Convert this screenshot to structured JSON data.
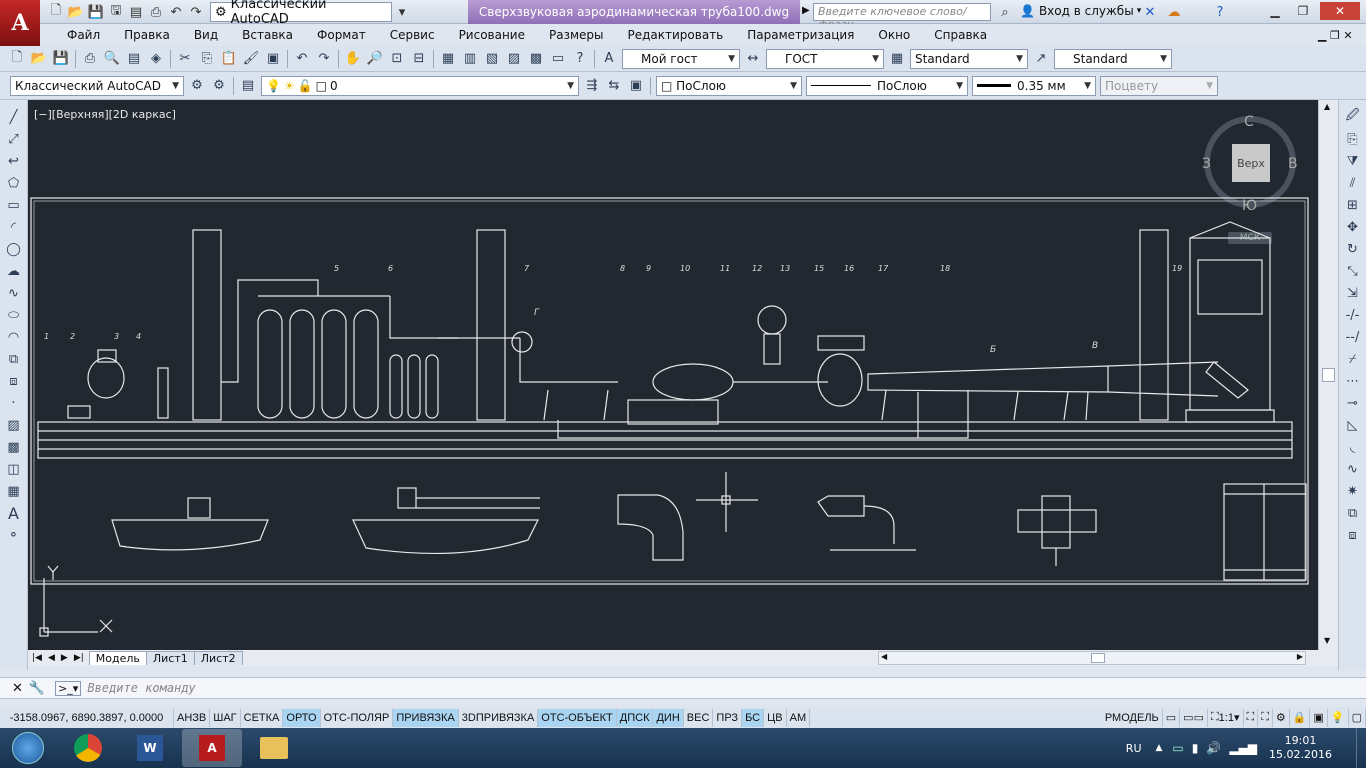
{
  "app": {
    "workspace": "Классический AutoCAD",
    "document_title": "Сверхзвуковая аэродинамическая труба100.dwg",
    "search_placeholder": "Введите ключевое слово/фразу",
    "signin": "Вход в службы"
  },
  "menu": [
    "Файл",
    "Правка",
    "Вид",
    "Вставка",
    "Формат",
    "Сервис",
    "Рисование",
    "Размеры",
    "Редактировать",
    "Параметризация",
    "Окно",
    "Справка"
  ],
  "styles": {
    "text_style": "Мой гост",
    "dim_style": "ГОСТ",
    "table_style": "Standard",
    "multileader_style": "Standard"
  },
  "layers": {
    "workspace": "Классический AutoCAD",
    "current_layer": "0",
    "color": "ПоСлою",
    "linetype": "ПоСлою",
    "lineweight": "0.35 мм",
    "plotstyle": "Поцвету"
  },
  "viewport": {
    "label": "[−][Верхняя][2D каркас]",
    "viewcube": {
      "top": "Верх",
      "n": "С",
      "s": "Ю",
      "w": "З",
      "e": "В",
      "ucs": "МСК"
    }
  },
  "drawing_callouts": [
    "1",
    "2",
    "3",
    "4",
    "5",
    "6",
    "7",
    "8",
    "9",
    "10",
    "11",
    "12",
    "13",
    "15",
    "16",
    "17",
    "18",
    "19",
    "Г",
    "Б",
    "В"
  ],
  "layout_tabs": [
    "Модель",
    "Лист1",
    "Лист2"
  ],
  "command_placeholder": "Введите команду",
  "status": {
    "coords": "-3158.0967, 6890.3897, 0.0000",
    "toggles": [
      {
        "label": "АНЗВ",
        "on": false
      },
      {
        "label": "ШАГ",
        "on": false
      },
      {
        "label": "СЕТКА",
        "on": false
      },
      {
        "label": "ОРТО",
        "on": true
      },
      {
        "label": "ОТС-ПОЛЯР",
        "on": false
      },
      {
        "label": "ПРИВЯЗКА",
        "on": true
      },
      {
        "label": "3DПРИВЯЗКА",
        "on": false
      },
      {
        "label": "ОТС-ОБЪЕКТ",
        "on": true
      },
      {
        "label": "ДПСК",
        "on": true
      },
      {
        "label": "ДИН",
        "on": true
      },
      {
        "label": "ВЕС",
        "on": false
      },
      {
        "label": "ПРЗ",
        "on": false
      },
      {
        "label": "БС",
        "on": true
      },
      {
        "label": "ЦВ",
        "on": false
      },
      {
        "label": "АМ",
        "on": false
      }
    ],
    "rmodel": "РМОДЕЛЬ",
    "scale": "1:1"
  },
  "taskbar": {
    "lang": "RU",
    "time": "19:01",
    "date": "15.02.2016"
  }
}
